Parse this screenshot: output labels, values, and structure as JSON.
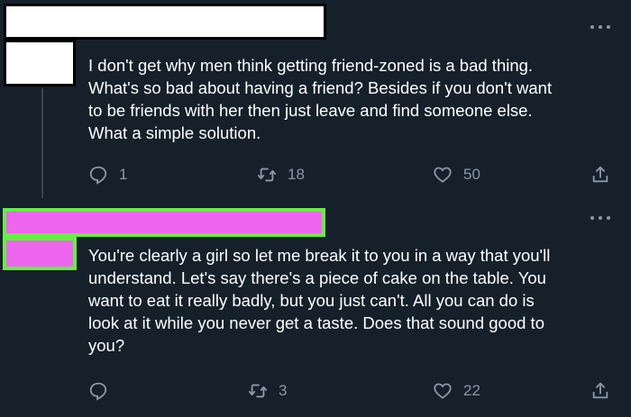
{
  "colors": {
    "background": "#15202b",
    "text": "#ffffff",
    "muted": "#8b98a5",
    "thread_line": "#38444d",
    "redaction_white": "#ffffff",
    "redaction_pink": "#ee66ee",
    "redaction_green": "#66ee44"
  },
  "tweets": [
    {
      "text": "I don't get why men think getting friend-zoned is a bad thing.\nWhat's so bad about having a friend? Besides if you don't want\nto be friends with her then just leave and find someone else.\nWhat a simple solution.",
      "actions": {
        "reply_icon": "reply-icon",
        "reply_count": "1",
        "retweet_icon": "retweet-icon",
        "retweet_count": "18",
        "like_icon": "heart-icon",
        "like_count": "50",
        "share_icon": "share-icon"
      }
    },
    {
      "text": "You're clearly a girl so let me break it to you in a way that you'll\nunderstand. Let's say there's a piece of cake on the table. You\nwant to eat it really badly, but you just can't. All you can do is\nlook at it while you never get a taste. Does that sound good to\nyou?",
      "actions": {
        "reply_icon": "reply-icon",
        "retweet_icon": "retweet-icon",
        "retweet_count": "3",
        "like_icon": "heart-icon",
        "like_count": "22",
        "share_icon": "share-icon"
      }
    }
  ]
}
